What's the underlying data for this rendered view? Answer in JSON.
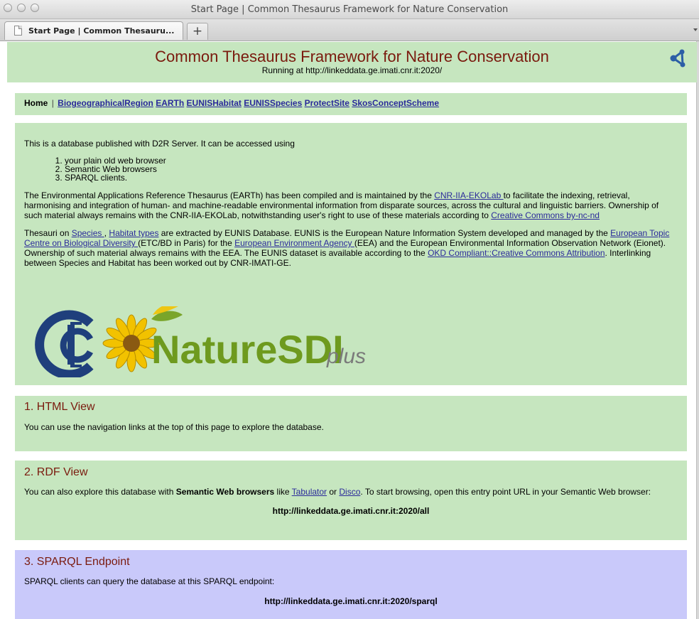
{
  "window": {
    "title": "Start Page | Common Thesaurus Framework for Nature Conservation"
  },
  "tabbar": {
    "tab_label": "Start Page | Common Thesauru...",
    "new_tab_label": "+"
  },
  "header": {
    "title": "Common Thesaurus Framework for Nature Conservation",
    "subtitle": "Running at http://linkeddata.ge.imati.cnr.it:2020/"
  },
  "nav": {
    "home": "Home",
    "separator": "|",
    "links": [
      "BiogeographicalRegion",
      "EARTh",
      "EUNISHabitat",
      "EUNISSpecies",
      "ProtectSite",
      "SkosConceptScheme"
    ]
  },
  "intro": {
    "lead": "This is a database published with D2R Server. It can be accessed using",
    "access_list": [
      "your plain old web browser",
      "Semantic Web browsers",
      "SPARQL clients."
    ],
    "earth_p1": "The Environmental Applications Reference Thesaurus (EARTh) has been compiled and is maintained by the ",
    "earth_link": "CNR-IIA-EKOLab ",
    "earth_p2": "to facilitate the indexing, retrieval, harmonising and integration of human- and machine-readable environmental information from disparate sources, across the cultural and linguistic barriers. Ownership of such material always remains with the CNR-IIA-EKOLab, notwithstanding user's right to use of these materials according to ",
    "earth_license": "Creative Commons by-nc-nd",
    "eunis_a": "Thesauri on ",
    "species_link": "Species ",
    "eunis_b": ", ",
    "habitat_link": "Habitat types",
    "eunis_c": " are extracted by EUNIS Database. EUNIS is the European Nature Information System developed and managed by the ",
    "etc_link": "European Topic Centre on Biological Diversity ",
    "eunis_d": "(ETC/BD in Paris) for the ",
    "eea_link": "European Environment Agency ",
    "eunis_e": "(EEA) and the European Environmental Information Observation Network (Eionet). Ownership of such material always remains with the EEA. The EUNIS dataset is available according to the ",
    "okd_link": "OKD Compliant::Creative Commons Attribution",
    "eunis_f": ". Interlinking between Species and Habitat has been worked out by CNR-IMATI-GE.",
    "logo_text": "NatureSDI",
    "logo_suffix": "plus"
  },
  "html_view": {
    "heading": "1. HTML View",
    "text": "You can use the navigation links at the top of this page to explore the database."
  },
  "rdf_view": {
    "heading": "2. RDF View",
    "text_a": "You can also explore this database with ",
    "bold": "Semantic Web browsers",
    "text_b": " like ",
    "tabulator": "Tabulator",
    "text_c": " or ",
    "disco": "Disco",
    "text_d": ". To start browsing, open this entry point URL in your Semantic Web browser:",
    "url": "http://linkeddata.ge.imati.cnr.it:2020/all"
  },
  "sparql": {
    "heading": "3. SPARQL Endpoint",
    "text": "SPARQL clients can query the database at this SPARQL endpoint:",
    "url": "http://linkeddata.ge.imati.cnr.it:2020/sparql"
  },
  "colors": {
    "panel_green": "#c6e6bf",
    "panel_blue": "#c9c9fa",
    "heading_red": "#7a1a0e",
    "link_blue": "#2a2a9a"
  }
}
